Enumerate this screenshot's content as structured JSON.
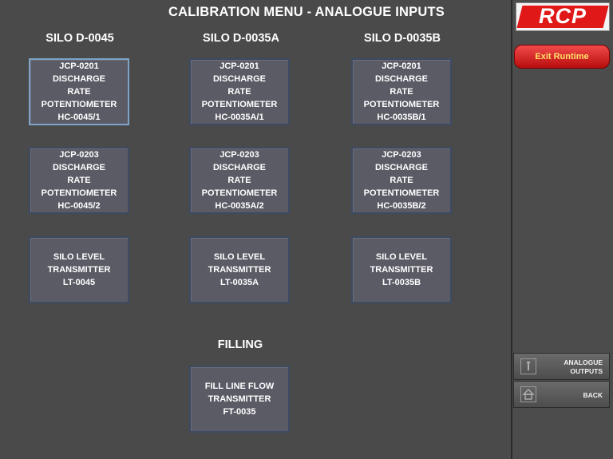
{
  "title": "CALIBRATION MENU - ANALOGUE INPUTS",
  "columns": {
    "c1": "SILO D-0045",
    "c2": "SILO D-0035A",
    "c3": "SILO D-0035B"
  },
  "tiles": {
    "r1c1": [
      "JCP-0201",
      "DISCHARGE",
      "RATE",
      "POTENTIOMETER",
      "HC-0045/1"
    ],
    "r1c2": [
      "JCP-0201",
      "DISCHARGE",
      "RATE",
      "POTENTIOMETER",
      "HC-0035A/1"
    ],
    "r1c3": [
      "JCP-0201",
      "DISCHARGE",
      "RATE",
      "POTENTIOMETER",
      "HC-0035B/1"
    ],
    "r2c1": [
      "JCP-0203",
      "DISCHARGE",
      "RATE",
      "POTENTIOMETER",
      "HC-0045/2"
    ],
    "r2c2": [
      "JCP-0203",
      "DISCHARGE",
      "RATE",
      "POTENTIOMETER",
      "HC-0035A/2"
    ],
    "r2c3": [
      "JCP-0203",
      "DISCHARGE",
      "RATE",
      "POTENTIOMETER",
      "HC-0035B/2"
    ],
    "r3c1": [
      "SILO LEVEL",
      "TRANSMITTER",
      "LT-0045"
    ],
    "r3c2": [
      "SILO LEVEL",
      "TRANSMITTER",
      "LT-0035A"
    ],
    "r3c3": [
      "SILO LEVEL",
      "TRANSMITTER",
      "LT-0035B"
    ],
    "fill": [
      "FILL LINE FLOW",
      "TRANSMITTER",
      "FT-0035"
    ]
  },
  "filling_label": "FILLING",
  "sidebar": {
    "logo": "RCP",
    "exit_label": "Exit Runtime",
    "analogue_outputs": [
      "ANALOGUE",
      "OUTPUTS"
    ],
    "back_label": "BACK",
    "analogue_outputs_icon": "info-icon",
    "back_icon": "home-icon"
  },
  "colors": {
    "background": "#4a4a4a",
    "tile": "#5b5b66",
    "tile_border": "#3c4a63",
    "exit_button": "#e02020",
    "exit_text": "#ffe06a",
    "logo_red": "#e01818"
  }
}
